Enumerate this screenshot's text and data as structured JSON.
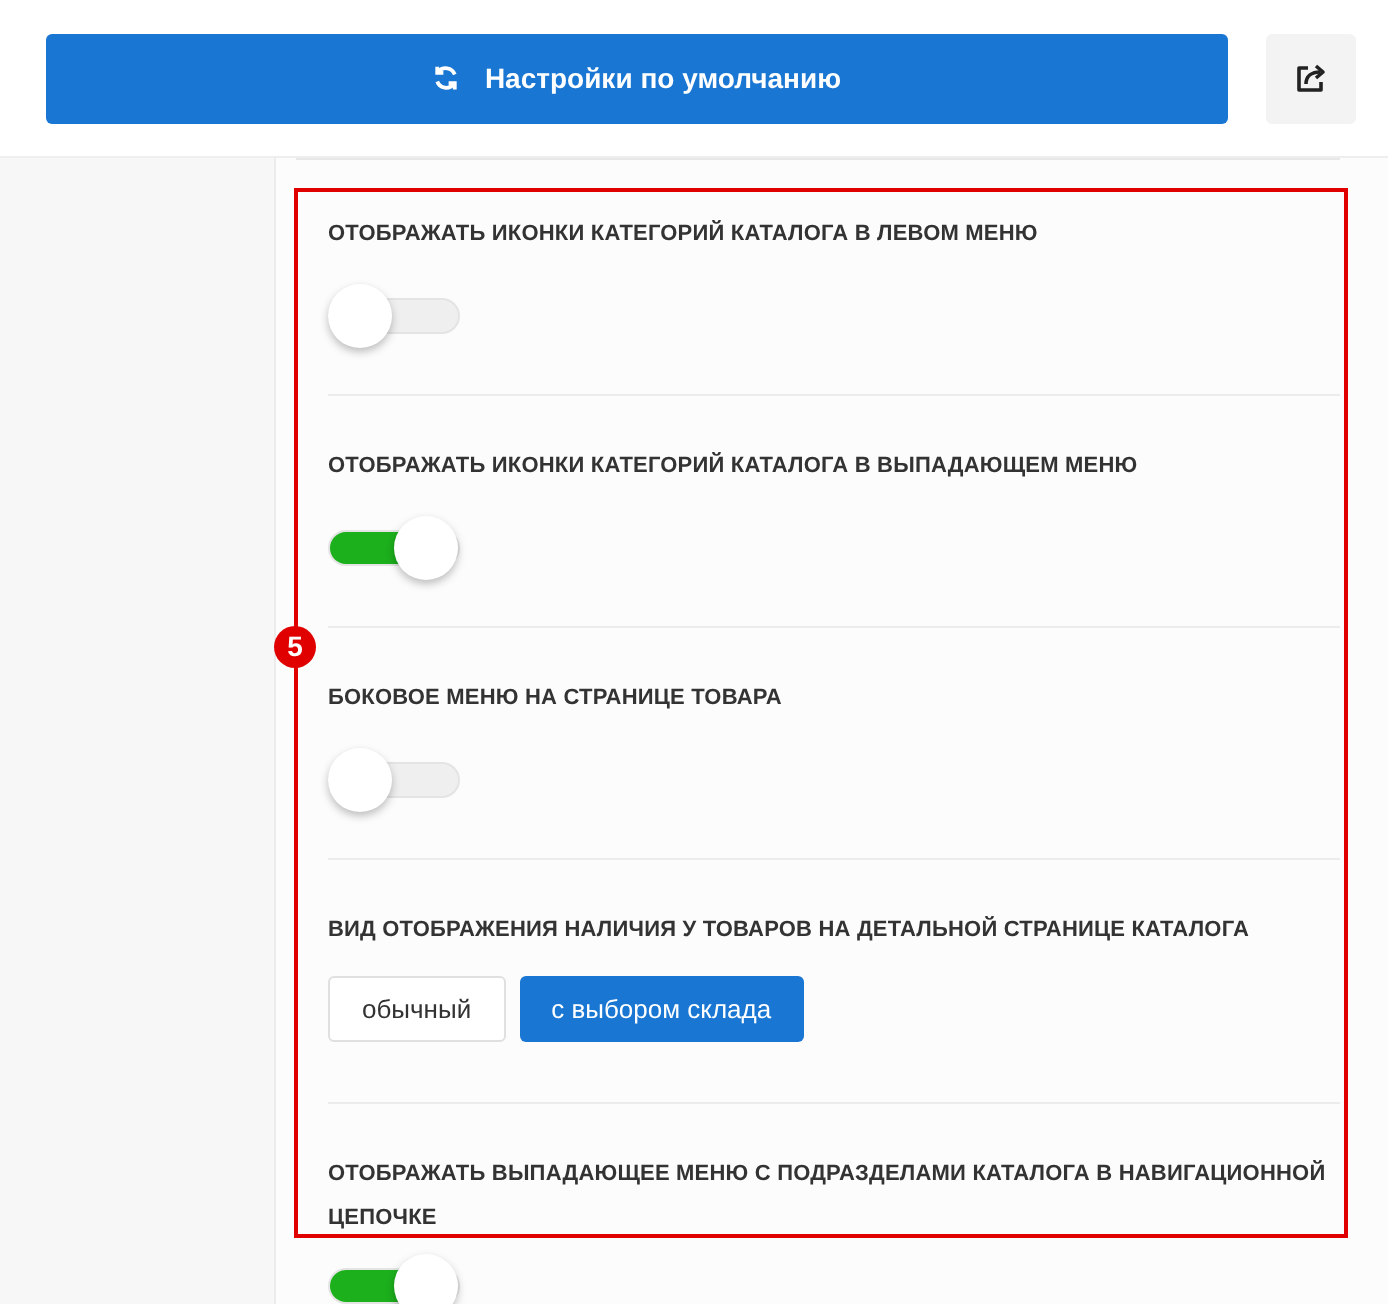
{
  "toolbar": {
    "reset_button": "Настройки по умолчанию"
  },
  "annotation": {
    "badge": "5"
  },
  "settings": [
    {
      "kind": "toggle",
      "title": "ОТОБРАЖАТЬ ИКОНКИ КАТЕГОРИЙ КАТАЛОГА В ЛЕВОМ МЕНЮ",
      "on": false
    },
    {
      "kind": "toggle",
      "title": "ОТОБРАЖАТЬ ИКОНКИ КАТЕГОРИЙ КАТАЛОГА В ВЫПАДАЮЩЕМ МЕНЮ",
      "on": true
    },
    {
      "kind": "toggle",
      "title": "БОКОВОЕ МЕНЮ НА СТРАНИЦЕ ТОВАРА",
      "on": false
    },
    {
      "kind": "choice",
      "title": "ВИД ОТОБРАЖЕНИЯ НАЛИЧИЯ У ТОВАРОВ НА ДЕТАЛЬНОЙ СТРАНИЦЕ КАТАЛОГА",
      "options": [
        {
          "label": "обычный",
          "selected": false
        },
        {
          "label": "с выбором склада",
          "selected": true
        }
      ]
    },
    {
      "kind": "toggle",
      "title": "ОТОБРАЖАТЬ ВЫПАДАЮЩЕЕ МЕНЮ С ПОДРАЗДЕЛАМИ КАТАЛОГА В НАВИГАЦИОННОЙ ЦЕПОЧКЕ",
      "on": true
    }
  ]
}
